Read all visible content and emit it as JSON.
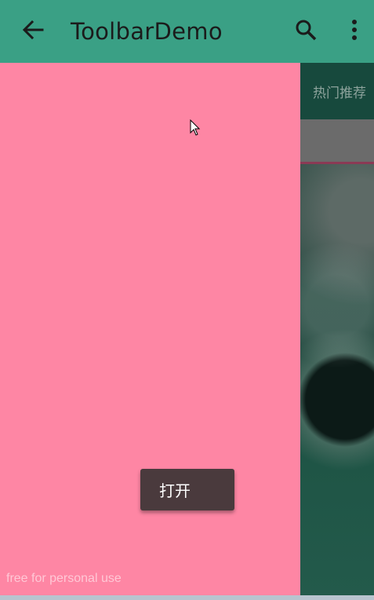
{
  "toolbar": {
    "title": "ToolbarDemo",
    "back_icon": "arrow-back-icon",
    "search_icon": "search-icon",
    "more_icon": "more-vert-icon"
  },
  "content": {
    "tab_label": "热门推荐"
  },
  "drawer": {
    "open_button_label": "打开",
    "watermark": "free for personal use"
  },
  "colors": {
    "toolbar": "#3aa085",
    "drawer": "#fe86a4",
    "button": "#4a3a3d"
  }
}
